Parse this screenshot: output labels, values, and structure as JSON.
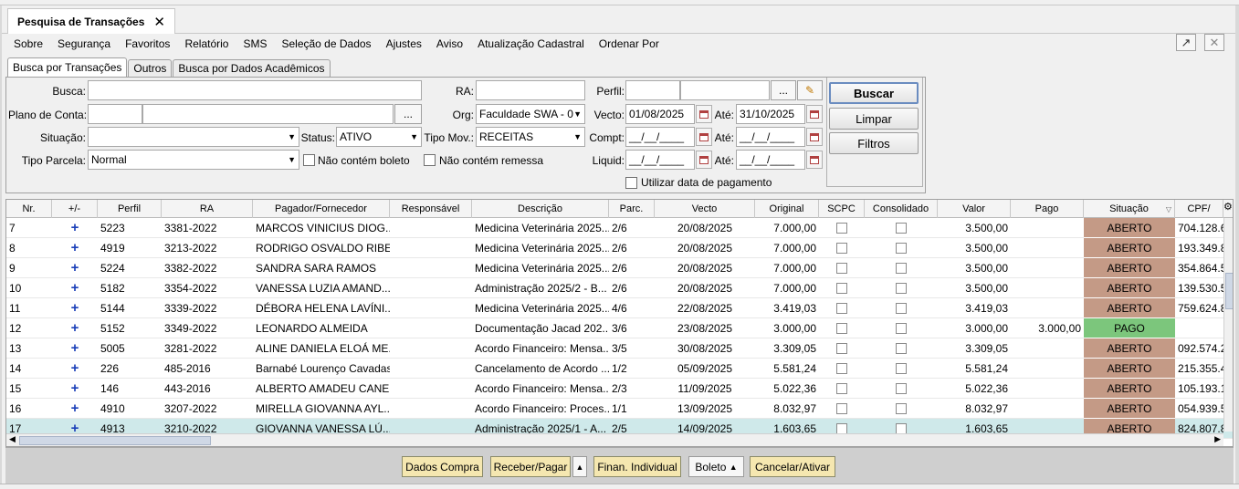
{
  "window": {
    "tab_title": "Pesquisa de Transações",
    "close_glyph": "✕"
  },
  "menu": [
    "Sobre",
    "Segurança",
    "Favoritos",
    "Relatório",
    "SMS",
    "Seleção de Dados",
    "Ajustes",
    "Aviso",
    "Atualização Cadastral",
    "Ordenar Por"
  ],
  "subtabs": [
    "Busca por Transações",
    "Outros",
    "Busca por Dados Acadêmicos"
  ],
  "filters": {
    "busca_label": "Busca:",
    "ra_label": "RA:",
    "perfil_label": "Perfil:",
    "plano_label": "Plano de Conta:",
    "org_label": "Org:",
    "org_value": "Faculdade SWA - 0",
    "vecto_label": "Vecto:",
    "vecto_from": "01/08/2025",
    "ate_label": "Até:",
    "vecto_to": "31/10/2025",
    "situacao_label": "Situação:",
    "status_label": "Status:",
    "status_value": "ATIVO",
    "tipo_mov_label": "Tipo Mov.:",
    "tipo_mov_value": "RECEITAS",
    "compt_label": "Compt:",
    "date_mask": "__/__/____",
    "tipo_parcela_label": "Tipo Parcela:",
    "tipo_parcela_value": "Normal",
    "nao_boleto_label": "Não contém boleto",
    "nao_remessa_label": "Não contém remessa",
    "liquid_label": "Liquid:",
    "utilizar_label": "Utilizar data de pagamento",
    "ellipsis": "..."
  },
  "buttons": {
    "buscar": "Buscar",
    "limpar": "Limpar",
    "filtros": "Filtros"
  },
  "columns": [
    "Nr.",
    "+/-",
    "Perfil",
    "RA",
    "Pagador/Fornecedor",
    "Responsável",
    "Descrição",
    "Parc.",
    "Vecto",
    "Original",
    "SCPC",
    "Consolidado",
    "Valor",
    "Pago",
    "Situação",
    "CPF/"
  ],
  "rows": [
    {
      "nr": "7",
      "pm": "+",
      "perfil": "5223",
      "ra": "3381-2022",
      "pagador": "MARCOS VINICIUS DIOG...",
      "resp": "",
      "desc": "Medicina Veterinária 2025...",
      "parc": "2/6",
      "vecto": "20/08/2025",
      "original": "7.000,00",
      "valor": "3.500,00",
      "pago": "",
      "situacao": "ABERTO",
      "cpf": "704.128.6"
    },
    {
      "nr": "8",
      "pm": "+",
      "perfil": "4919",
      "ra": "3213-2022",
      "pagador": "RODRIGO OSVALDO RIBEI...",
      "resp": "",
      "desc": "Medicina Veterinária 2025...",
      "parc": "2/6",
      "vecto": "20/08/2025",
      "original": "7.000,00",
      "valor": "3.500,00",
      "pago": "",
      "situacao": "ABERTO",
      "cpf": "193.349.8"
    },
    {
      "nr": "9",
      "pm": "+",
      "perfil": "5224",
      "ra": "3382-2022",
      "pagador": "SANDRA SARA RAMOS",
      "resp": "",
      "desc": "Medicina Veterinária 2025...",
      "parc": "2/6",
      "vecto": "20/08/2025",
      "original": "7.000,00",
      "valor": "3.500,00",
      "pago": "",
      "situacao": "ABERTO",
      "cpf": "354.864.5"
    },
    {
      "nr": "10",
      "pm": "+",
      "perfil": "5182",
      "ra": "3354-2022",
      "pagador": "VANESSA LUZIA AMAND...",
      "resp": "",
      "desc": "Administração 2025/2 - B...",
      "parc": "2/6",
      "vecto": "20/08/2025",
      "original": "7.000,00",
      "valor": "3.500,00",
      "pago": "",
      "situacao": "ABERTO",
      "cpf": "139.530.5"
    },
    {
      "nr": "11",
      "pm": "+",
      "perfil": "5144",
      "ra": "3339-2022",
      "pagador": "DÉBORA HELENA LAVÍNI...",
      "resp": "",
      "desc": "Medicina Veterinária 2025...",
      "parc": "4/6",
      "vecto": "22/08/2025",
      "original": "3.419,03",
      "valor": "3.419,03",
      "pago": "",
      "situacao": "ABERTO",
      "cpf": "759.624.8"
    },
    {
      "nr": "12",
      "pm": "+",
      "perfil": "5152",
      "ra": "3349-2022",
      "pagador": "LEONARDO ALMEIDA",
      "resp": "",
      "desc": "Documentação Jacad 202...",
      "parc": "3/6",
      "vecto": "23/08/2025",
      "original": "3.000,00",
      "valor": "3.000,00",
      "pago": "3.000,00",
      "situacao": "PAGO",
      "cpf": ""
    },
    {
      "nr": "13",
      "pm": "+",
      "perfil": "5005",
      "ra": "3281-2022",
      "pagador": "ALINE DANIELA ELOÁ ME...",
      "resp": "",
      "desc": "Acordo Financeiro: Mensa...",
      "parc": "3/5",
      "vecto": "30/08/2025",
      "original": "3.309,05",
      "valor": "3.309,05",
      "pago": "",
      "situacao": "ABERTO",
      "cpf": "092.574.2"
    },
    {
      "nr": "14",
      "pm": "+",
      "perfil": "226",
      "ra": "485-2016",
      "pagador": "Barnabé Lourenço Cavadas",
      "resp": "",
      "desc": "Cancelamento de Acordo ...",
      "parc": "1/2",
      "vecto": "05/09/2025",
      "original": "5.581,24",
      "valor": "5.581,24",
      "pago": "",
      "situacao": "ABERTO",
      "cpf": "215.355.4"
    },
    {
      "nr": "15",
      "pm": "+",
      "perfil": "146",
      "ra": "443-2016",
      "pagador": "ALBERTO AMADEU CANE...",
      "resp": "",
      "desc": "Acordo Financeiro: Mensa...",
      "parc": "2/3",
      "vecto": "11/09/2025",
      "original": "5.022,36",
      "valor": "5.022,36",
      "pago": "",
      "situacao": "ABERTO",
      "cpf": "105.193.1"
    },
    {
      "nr": "16",
      "pm": "+",
      "perfil": "4910",
      "ra": "3207-2022",
      "pagador": "MIRELLA GIOVANNA AYL...",
      "resp": "",
      "desc": "Acordo Financeiro: Proces...",
      "parc": "1/1",
      "vecto": "13/09/2025",
      "original": "8.032,97",
      "valor": "8.032,97",
      "pago": "",
      "situacao": "ABERTO",
      "cpf": "054.939.5"
    },
    {
      "nr": "17",
      "pm": "+",
      "perfil": "4913",
      "ra": "3210-2022",
      "pagador": "GIOVANNA VANESSA LÚ...",
      "resp": "",
      "desc": "Administração 2025/1 - A...",
      "parc": "2/5",
      "vecto": "14/09/2025",
      "original": "1.603,65",
      "valor": "1.603,65",
      "pago": "",
      "situacao": "ABERTO",
      "cpf": "824.807.8"
    }
  ],
  "bottom_buttons": [
    "Dados Compra",
    "Receber/Pagar",
    "Finan. Individual",
    "Boleto",
    "Cancelar/Ativar"
  ],
  "colors": {
    "aberto": "#c49a86",
    "pago": "#7cc67c",
    "selected_row": "#cfe9ea",
    "bottom_btn": "#f5e7b0"
  }
}
